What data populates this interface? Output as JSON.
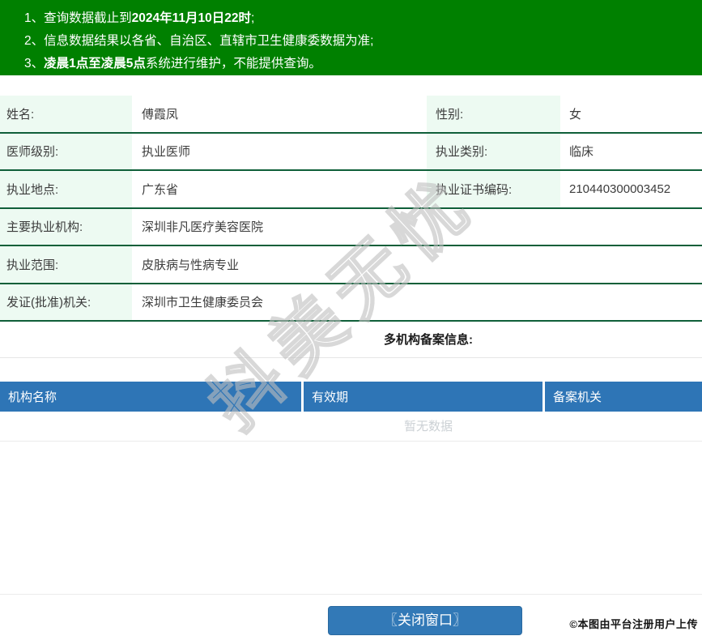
{
  "banner": {
    "bg": "#008000",
    "notices": [
      {
        "prefix": "1、查询数据截止到",
        "bold": "2024年11月10日22时",
        "suffix": ";"
      },
      {
        "prefix": "2、信息数据结果以各省、自治区、直辖市卫生健康委数据为准;",
        "bold": "",
        "suffix": ""
      },
      {
        "prefix": "3、",
        "bold": "凌晨1点至凌晨5点",
        "suffix": "系统进行维护，不能提供查询。"
      }
    ]
  },
  "profile": {
    "rows": [
      {
        "label1": "姓名:",
        "value1": "傅霞凤",
        "label2": "性别:",
        "value2": "女"
      },
      {
        "label1": "医师级别:",
        "value1": "执业医师",
        "label2": "执业类别:",
        "value2": "临床"
      },
      {
        "label1": "执业地点:",
        "value1": "广东省",
        "label2": "执业证书编码:",
        "value2": "210440300003452"
      },
      {
        "label1": "主要执业机构:",
        "value1": "深圳非凡医疗美容医院"
      },
      {
        "label1": "执业范围:",
        "value1": "皮肤病与性病专业"
      },
      {
        "label1": "发证(批准)机关:",
        "value1": "深圳市卫生健康委员会"
      }
    ]
  },
  "filing": {
    "title": "多机构备案信息:",
    "columns": [
      "机构名称",
      "有效期",
      "备案机关"
    ],
    "empty_text": "暂无数据",
    "header_bg": "#2e75b6"
  },
  "watermark": {
    "text": "抖美无忧"
  },
  "footer": {
    "close_button": "〖关闭窗口〗",
    "caption": "©本图由平台注册用户上传"
  },
  "colors": {
    "banner_green": "#008000",
    "row_border_green": "#0f5f39",
    "label_cell_bg": "#edfaf2",
    "table_header_blue": "#2e75b6",
    "button_blue": "#3279b7",
    "empty_text_gray": "#ccd1d5"
  }
}
